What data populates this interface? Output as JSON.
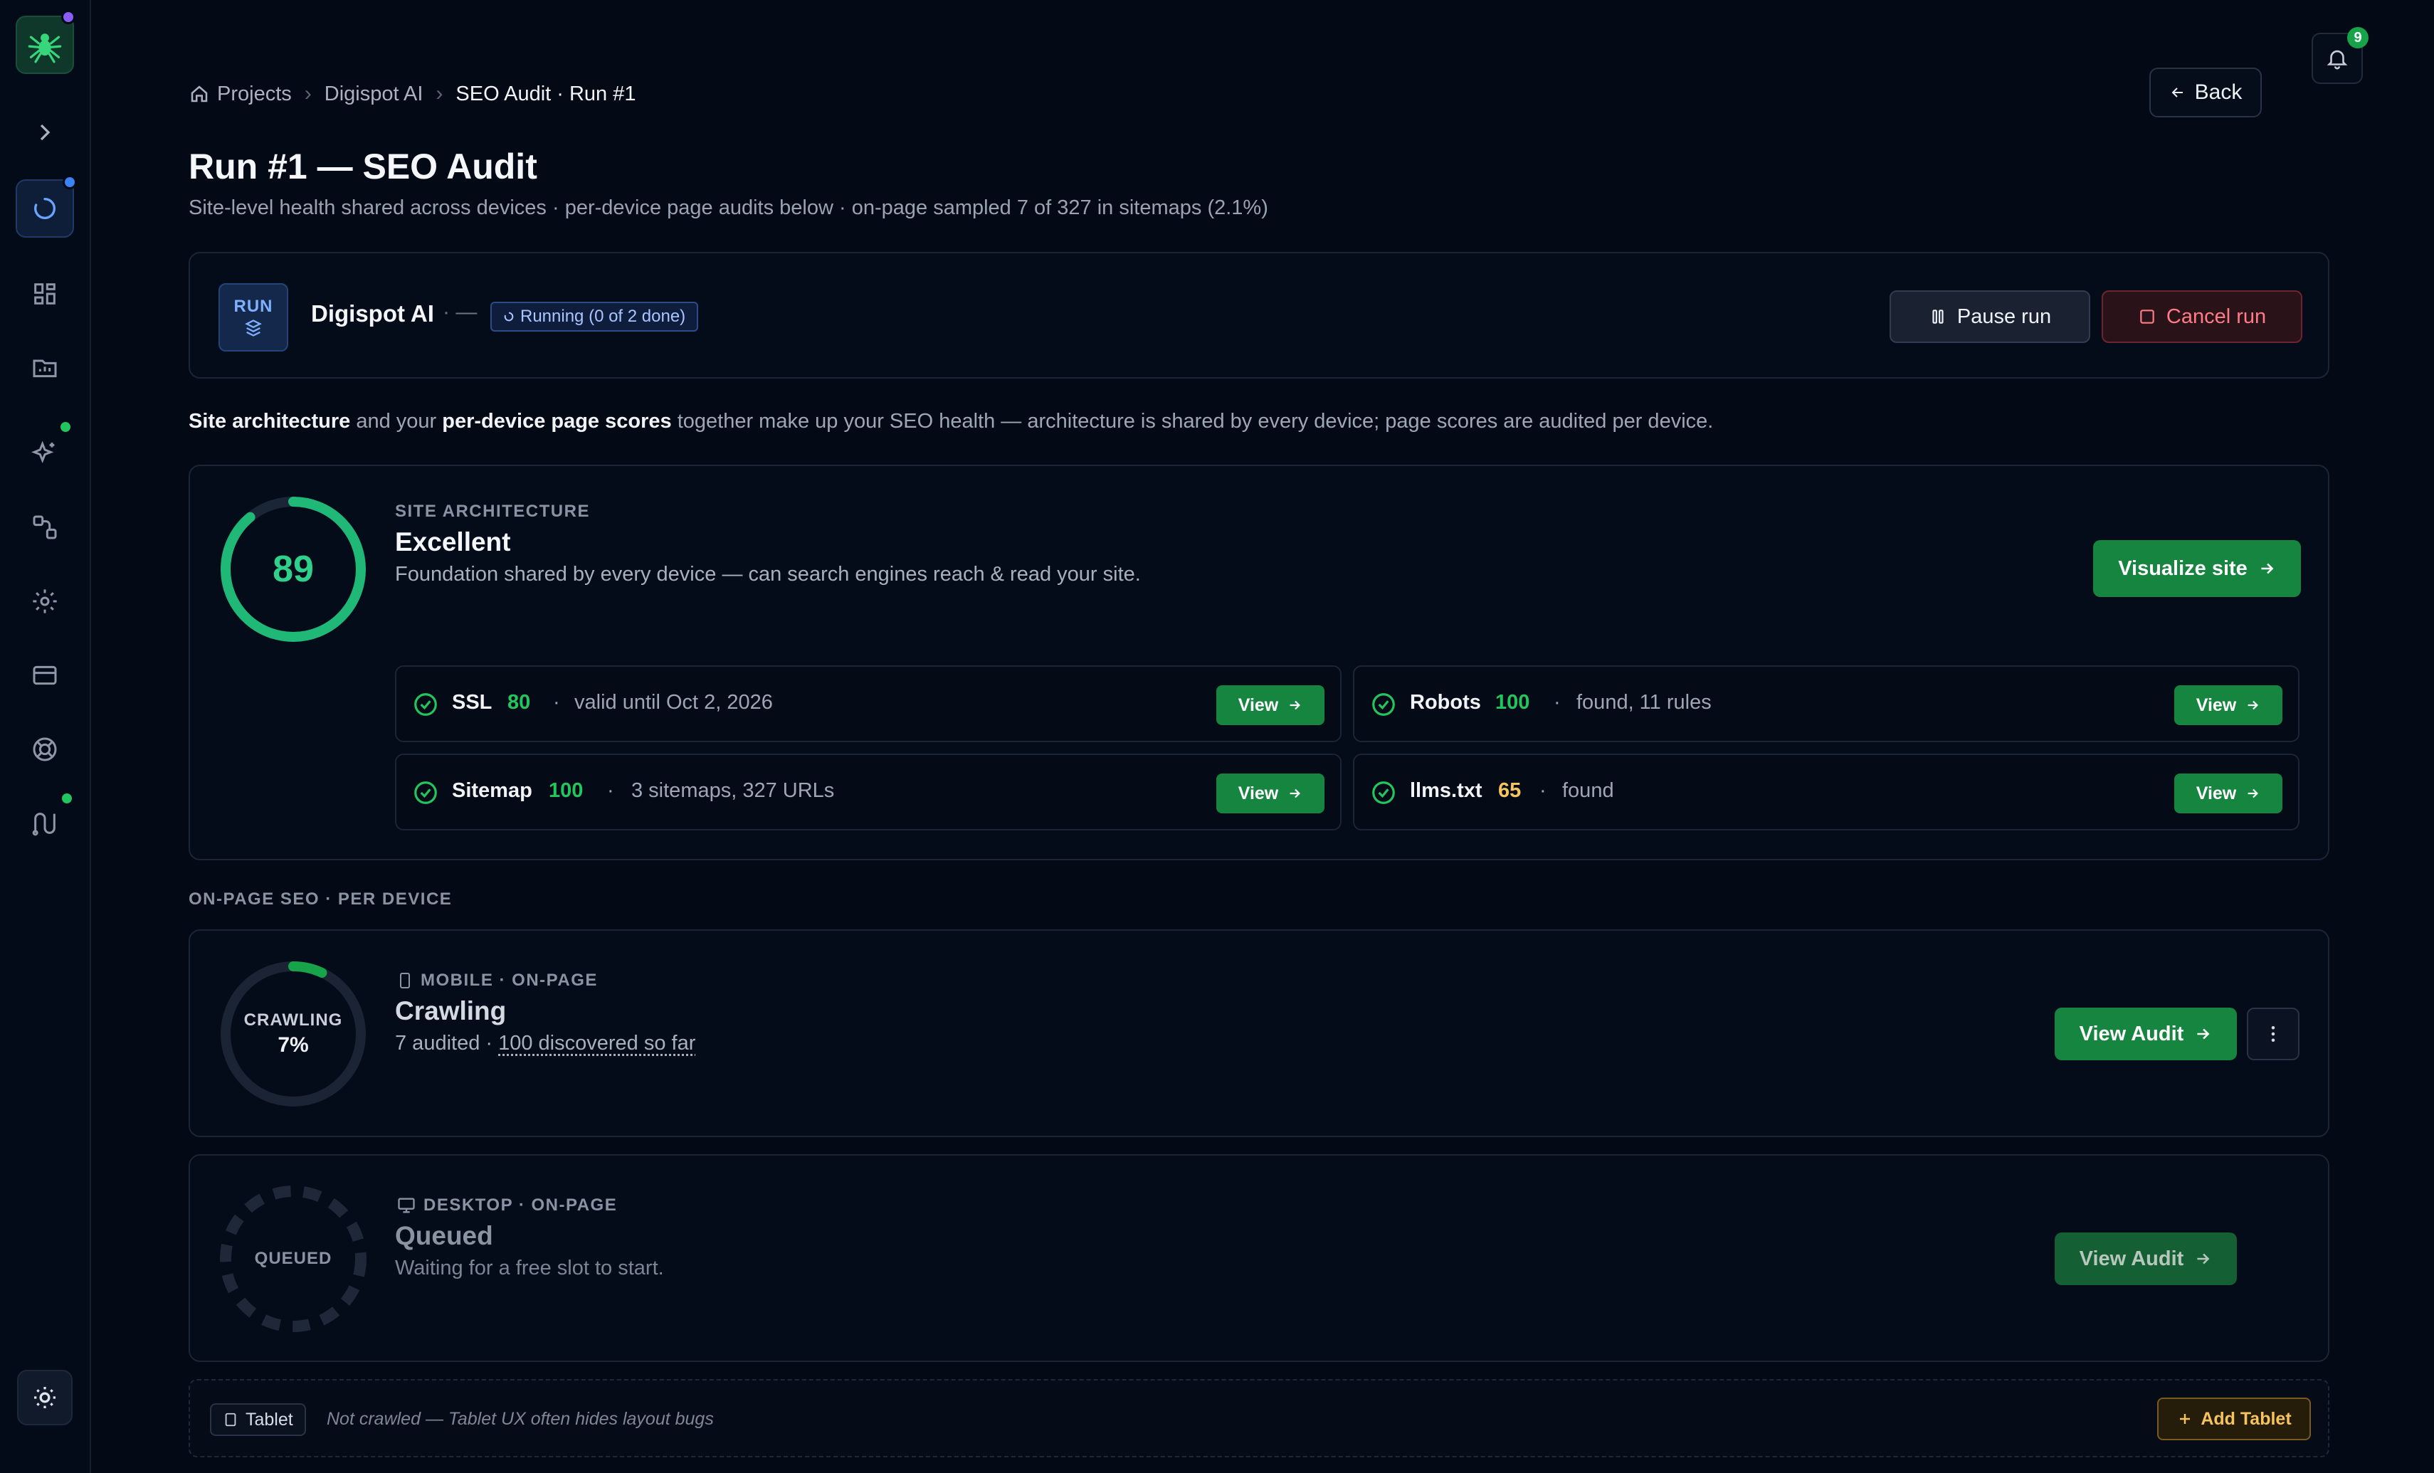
{
  "colors": {
    "accent_green": "#16853f",
    "score_green": "#22c55e",
    "score_amber": "#f5c45e",
    "cancel_red": "#ff7c86",
    "running_blue": "#a9c4ff"
  },
  "sidebar": {
    "items": [
      {
        "icon": "spider-logo-icon"
      },
      {
        "icon": "chevron-right-icon"
      },
      {
        "icon": "loading-spinner-icon"
      },
      {
        "icon": "dashboard-grid-icon"
      },
      {
        "icon": "reports-folder-icon"
      },
      {
        "icon": "sparkles-icon"
      },
      {
        "icon": "workflow-icon"
      },
      {
        "icon": "gear-icon"
      },
      {
        "icon": "credit-card-icon"
      },
      {
        "icon": "lifebuoy-icon"
      },
      {
        "icon": "integrations-icon"
      },
      {
        "icon": "theme-toggle-icon"
      }
    ]
  },
  "header": {
    "breadcrumb": [
      "Projects",
      "Digispot AI",
      "SEO Audit · Run #1"
    ],
    "back_label": "Back",
    "notification_count": "9",
    "title": "Run #1 — SEO Audit",
    "subtitle": "Site-level health shared across devices · per-device page audits below · on-page sampled 7 of 327 in sitemaps (2.1%)"
  },
  "run": {
    "badge": "RUN",
    "project": "Digispot AI",
    "separator": "·  —",
    "status": "Running (0 of 2 done)",
    "pause_label": "Pause run",
    "cancel_label": "Cancel run"
  },
  "intro": {
    "part1": "Site architecture",
    "part2": " and your ",
    "part3": "per-device page scores",
    "part4": " together make up your SEO health — architecture is shared by every device; page scores are audited per device."
  },
  "architecture": {
    "eyebrow": "SITE ARCHITECTURE",
    "score": 89,
    "score_label": "89",
    "rating": "Excellent",
    "description": "Foundation shared by every device — can search engines reach & read your site.",
    "visualize_label": "Visualize site",
    "metrics": [
      {
        "name": "SSL",
        "score": "80",
        "detail": "valid until Oct 2, 2026",
        "view": "View"
      },
      {
        "name": "Robots",
        "score": "100",
        "detail": "found, 11 rules",
        "view": "View"
      },
      {
        "name": "Sitemap",
        "score": "100",
        "detail": "3 sitemaps, 327 URLs",
        "view": "View"
      },
      {
        "name": "llms.txt",
        "score": "65",
        "detail": "found",
        "view": "View"
      }
    ]
  },
  "onpage": {
    "section_label": "ON-PAGE SEO · PER DEVICE",
    "mobile": {
      "eyebrow": "MOBILE · ON-PAGE",
      "state_label": "CRAWLING",
      "progress_label": "7%",
      "progress": 0.07,
      "title": "Crawling",
      "audited": "7 audited · ",
      "discovered": "100 discovered so far",
      "view_label": "View Audit"
    },
    "desktop": {
      "eyebrow": "DESKTOP · ON-PAGE",
      "state_label": "QUEUED",
      "title": "Queued",
      "description": "Waiting for a free slot to start.",
      "view_label": "View Audit"
    },
    "tablet": {
      "chip": "Tablet",
      "note": "Not crawled — Tablet UX often hides layout bugs",
      "add_label": "Add Tablet"
    }
  }
}
